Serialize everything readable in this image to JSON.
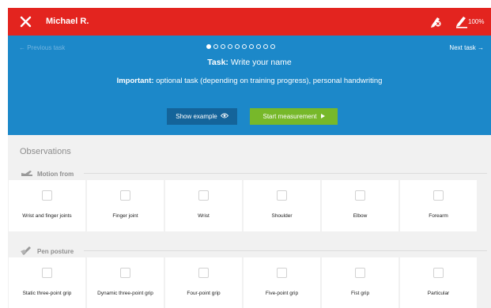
{
  "topbar": {
    "user_name": "Michael R.",
    "battery_percent": "100%",
    "icons": [
      "close-icon",
      "pen-disconnected-icon",
      "pen-battery-icon"
    ],
    "color": "#e3241f"
  },
  "header": {
    "previous_task": "← Previous task",
    "next_task": "Next task →",
    "progress": {
      "total": 10,
      "current": 1
    },
    "task_label": "Task:",
    "task_value": "Write your name",
    "important_label": "Important:",
    "important_value": "optional task (depending on training progress), personal handwriting",
    "show_example": "Show example",
    "start_measurement": "Start measurement",
    "color": "#1c88c9",
    "start_color": "#77b82a"
  },
  "observations": {
    "title": "Observations",
    "sections": [
      {
        "label": "Motion from",
        "icon": "writing-hand-icon",
        "items": [
          "Wrist and finger joints",
          "Finger joint",
          "Wrist",
          "Shoulder",
          "Elbow",
          "Forearm"
        ]
      },
      {
        "label": "Pen posture",
        "icon": "pen-posture-icon",
        "items": [
          "Static three-point grip",
          "Dynamic three-point grip",
          "Four-point grip",
          "Five-point grip",
          "Fist grip",
          "Particular"
        ]
      }
    ]
  }
}
